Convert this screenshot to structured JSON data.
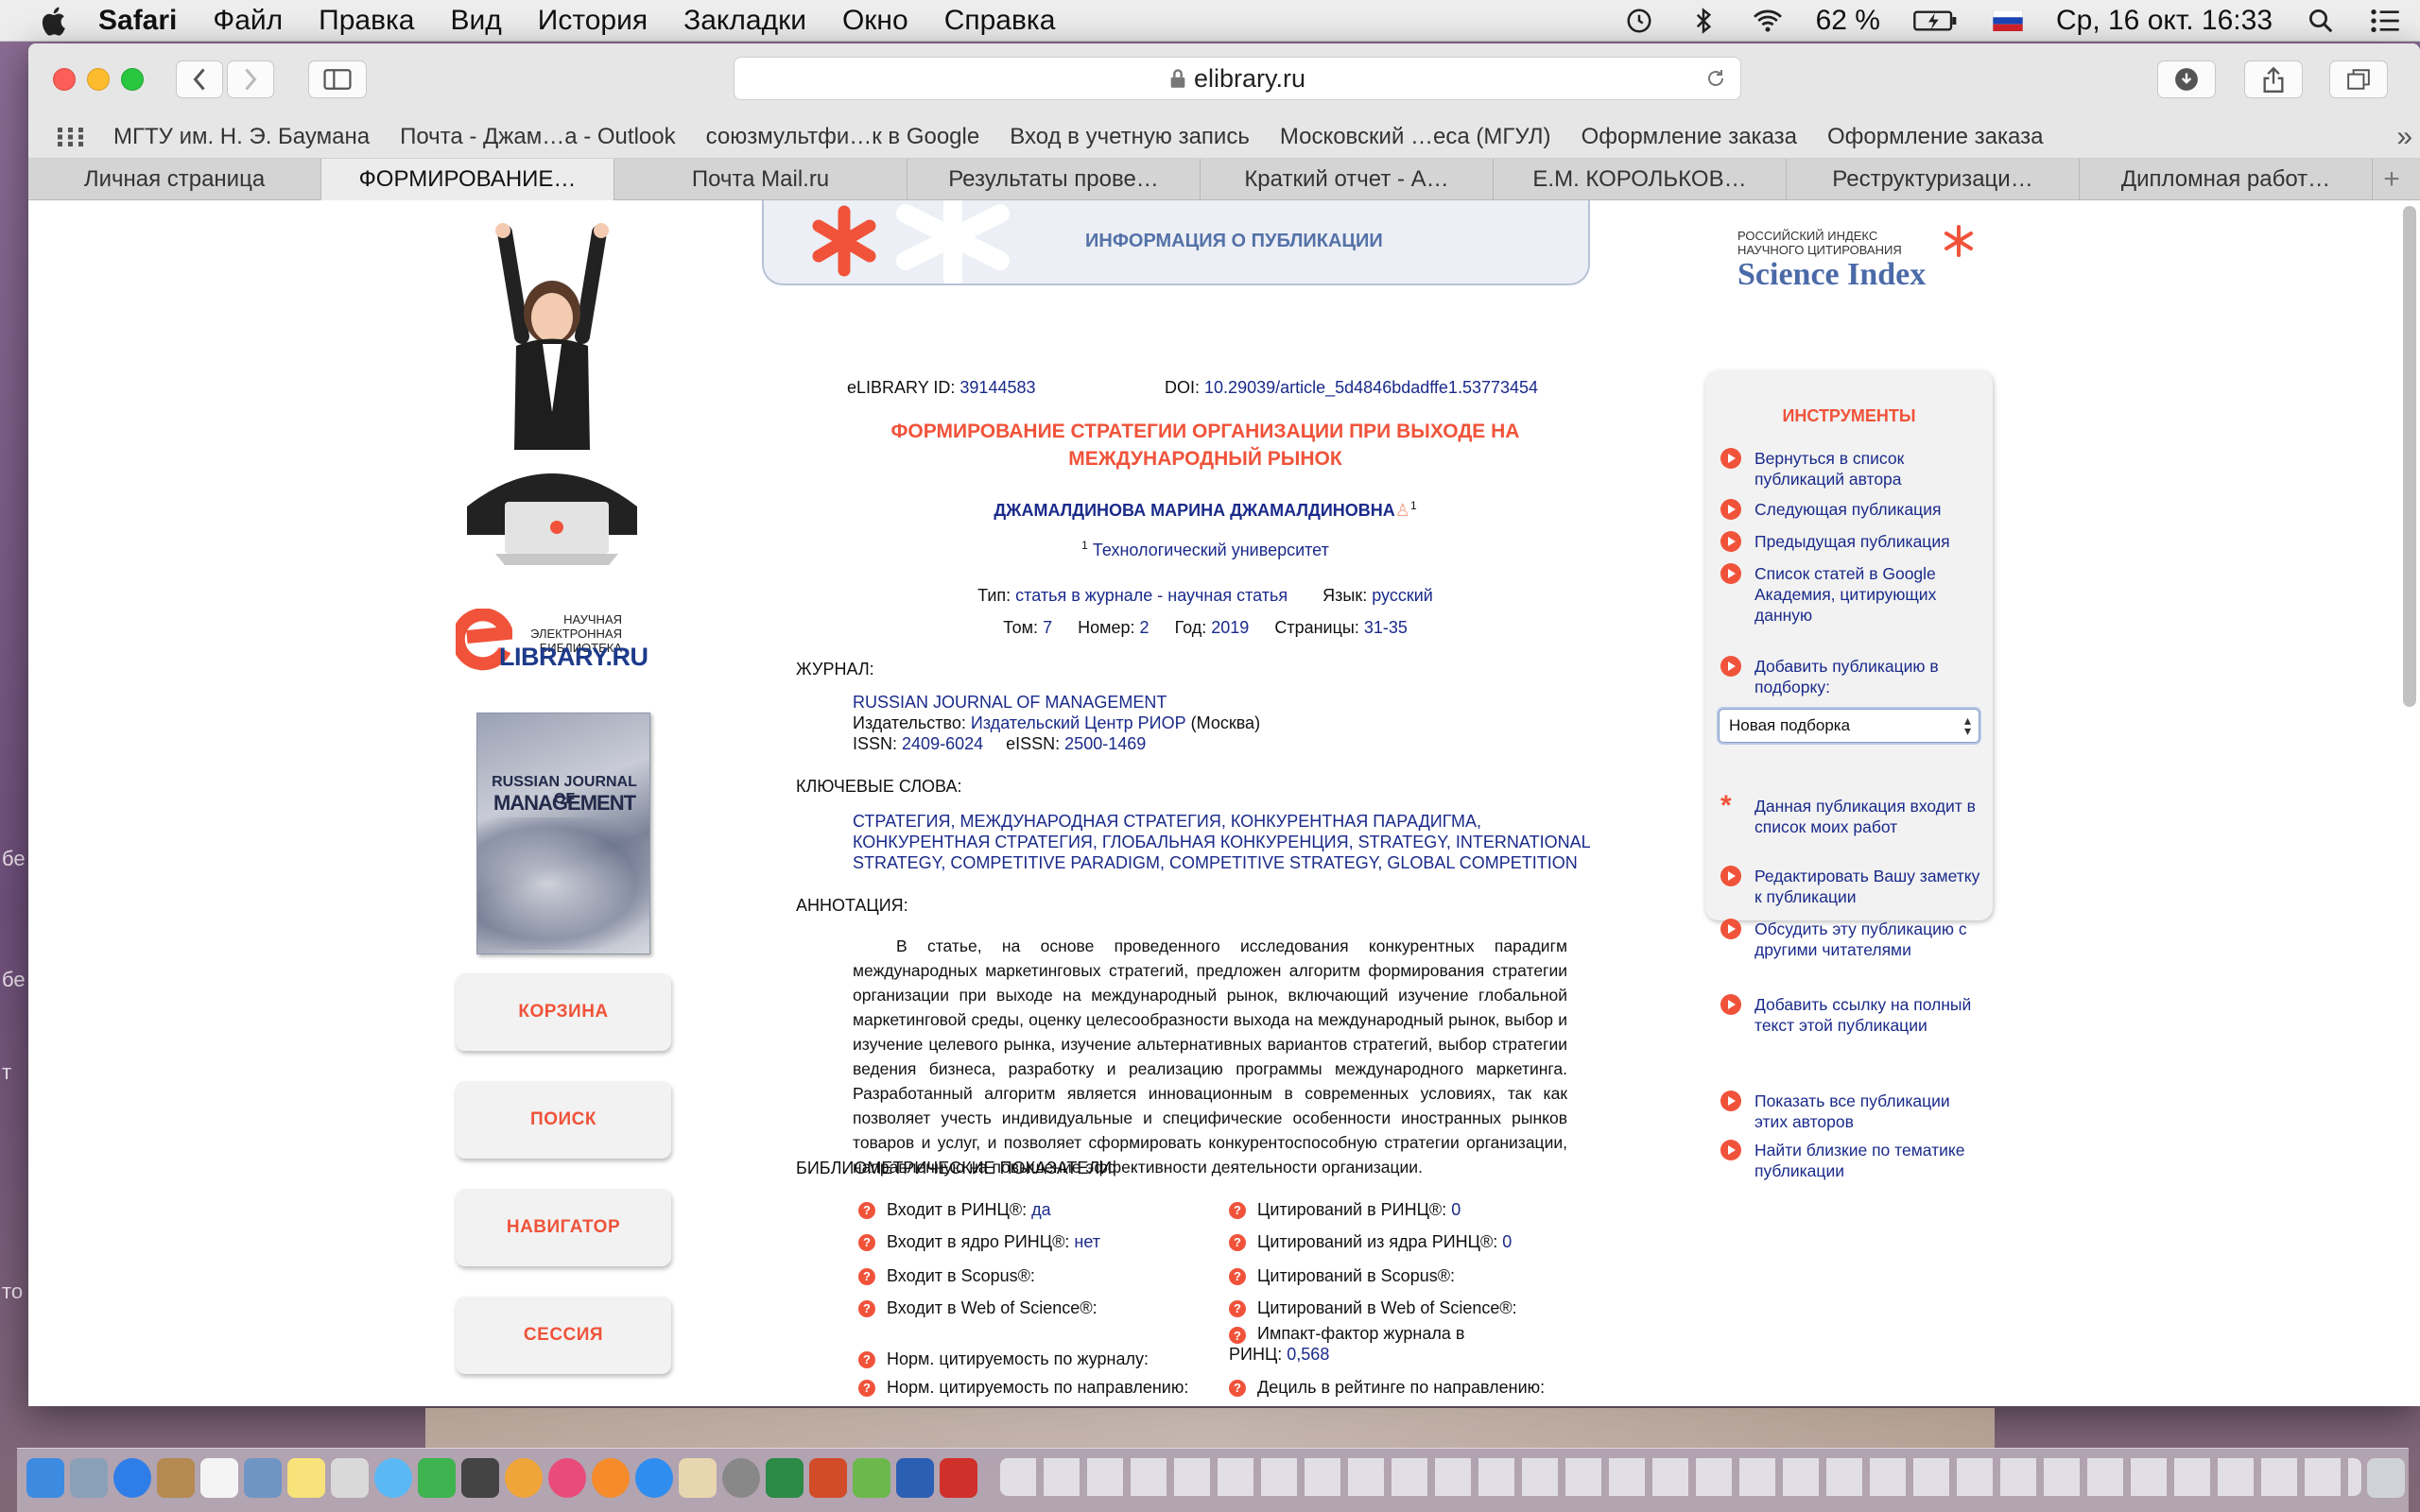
{
  "menubar": {
    "app": "Safari",
    "menus": [
      "Файл",
      "Правка",
      "Вид",
      "История",
      "Закладки",
      "Окно",
      "Справка"
    ],
    "battery": "62 %",
    "datetime": "Ср, 16 окт.  16:33"
  },
  "browser": {
    "url": "elibrary.ru",
    "bookmarks": [
      "МГТУ им. Н. Э. Баумана",
      "Почта - Джам…а - Outlook",
      "союзмультфи…к в Google",
      "Вход в учетную запись",
      "Московский …еса (МГУЛ)",
      "Оформление заказа",
      "Оформление заказа"
    ],
    "tabs": [
      "Личная страница",
      "ФОРМИРОВАНИЕ…",
      "Почта Mail.ru",
      "Результаты прове…",
      "Краткий отчет - А…",
      "Е.М. КОРОЛЬКОВ…",
      "Реструктуризаци…",
      "Дипломная работ…"
    ],
    "active_tab": 1
  },
  "left": {
    "logo_small": "НАУЧНАЯ ЭЛЕКТРОННАЯ БИБЛИОТЕКА",
    "logo_big": "LIBRARY.RU",
    "cover_line1": "RUSSIAN JOURNAL OF",
    "cover_line2": "MANAGEMENT",
    "buttons": [
      "КОРЗИНА",
      "ПОИСК",
      "НАВИГАТОР",
      "СЕССИЯ"
    ]
  },
  "publication": {
    "header": "ИНФОРМАЦИЯ О ПУБЛИКАЦИИ",
    "id_label": "eLIBRARY ID:",
    "id": "39144583",
    "doi_label": "DOI:",
    "doi": "10.29039/article_5d4846bdadffe1.53773454",
    "title_line1": "ФОРМИРОВАНИЕ СТРАТЕГИИ ОРГАНИЗАЦИИ ПРИ ВЫХОДЕ НА",
    "title_line2": "МЕЖДУНАРОДНЫЙ РЫНОК",
    "author": "ДЖАМАЛДИНОВА МАРИНА ДЖАМАЛДИНОВНА",
    "affiliation": "Технологический университет",
    "type_label": "Тип:",
    "type": "статья в журнале - научная статья",
    "lang_label": "Язык:",
    "lang": "русский",
    "vol_label": "Том:",
    "vol": "7",
    "num_label": "Номер:",
    "num": "2",
    "year_label": "Год:",
    "year": "2019",
    "pages_label": "Страницы:",
    "pages": "31-35",
    "journal_label": "ЖУРНАЛ:",
    "journal": "RUSSIAN JOURNAL OF MANAGEMENT",
    "publisher_label": "Издательство:",
    "publisher": "Издательский Центр РИОР",
    "publisher_city": "(Москва)",
    "issn_label": "ISSN:",
    "issn": "2409-6024",
    "eissn_label": "eISSN:",
    "eissn": "2500-1469",
    "keywords_label": "КЛЮЧЕВЫЕ СЛОВА:",
    "keywords_line1": "СТРАТЕГИЯ, МЕЖДУНАРОДНАЯ СТРАТЕГИЯ, КОНКУРЕНТНАЯ ПАРАДИГМА,",
    "keywords_line2": "КОНКУРЕНТНАЯ СТРАТЕГИЯ, ГЛОБАЛЬНАЯ КОНКУРЕНЦИЯ, STRATEGY, INTERNATIONAL",
    "keywords_line3": "STRATEGY, COMPETITIVE PARADIGM, COMPETITIVE STRATEGY, GLOBAL COMPETITION",
    "abstract_label": "АННОТАЦИЯ:",
    "abstract": "В статье, на основе проведенного исследования конкурентных парадигм международных маркетинговых стратегий, предложен алгоритм формирования стратегии организации при выходе на международный рынок, включающий изучение глобальной маркетинговой среды, оценку целесообразности выхода на международный рынок, выбор и изучение целевого рынка, изучение альтернативных вариантов стратегий, выбор стратегии ведения бизнеса, разработку и реализацию программы международного маркетинга. Разработанный алгоритм является инновационным в современных условиях, так как позволяет учесть индивидуальные и специфические особенности иностранных рынков товаров и услуг, и позволяет сформировать конкурентоспособную стратегии организации, направленную на повышение эффективности деятельности организации.",
    "biblio_label": "БИБЛИОМЕТРИЧЕСКИЕ ПОКАЗАТЕЛИ:"
  },
  "metrics_left": [
    {
      "label": "Входит в РИНЦ®:",
      "value": "да"
    },
    {
      "label": "Входит в ядро РИНЦ®:",
      "value": "нет"
    },
    {
      "label": "Входит в Scopus®:",
      "value": ""
    },
    {
      "label": "Входит в Web of Science®:",
      "value": ""
    },
    {
      "label": "Норм. цитируемость по журналу:",
      "value": ""
    },
    {
      "label": "Норм. цитируемость по направлению:",
      "value": ""
    }
  ],
  "metrics_right": [
    {
      "label": "Цитирований в РИНЦ®:",
      "value": "0"
    },
    {
      "label": "Цитирований из ядра РИНЦ®:",
      "value": "0"
    },
    {
      "label": "Цитирований в Scopus®:",
      "value": ""
    },
    {
      "label": "Цитирований в Web of Science®:",
      "value": ""
    },
    {
      "label": "Импакт-фактор журнала в",
      "label2": "РИНЦ:",
      "value": "0,568"
    },
    {
      "label": "Дециль в рейтинге по направлению:",
      "value": ""
    }
  ],
  "right": {
    "si_small1": "РОССИЙСКИЙ ИНДЕКС",
    "si_small2": "НАУЧНОГО ЦИТИРОВАНИЯ",
    "si_big": "Science Index",
    "tools_title": "ИНСТРУМЕНТЫ",
    "items": [
      "Вернуться в список публикаций автора",
      "Следующая публикация",
      "Предыдущая публикация",
      "Список статей в Google Академия, цитирующих данную",
      "Добавить публикацию в подборку:",
      "Данная публикация входит в список моих работ",
      "Редактировать Вашу заметку к публикации",
      "Обсудить эту публикацию с другими читателями",
      "Добавить ссылку на полный текст этой публикации",
      "Показать все публикации этих авторов",
      "Найти близкие по тематике публикации"
    ],
    "select_value": "Новая подборка"
  },
  "desktop_labels": [
    "бе",
    "бе",
    "т",
    "то"
  ],
  "colors": {
    "accent": "#f0533a",
    "link": "#1a2a8a",
    "panel": "#f2f2f2"
  }
}
